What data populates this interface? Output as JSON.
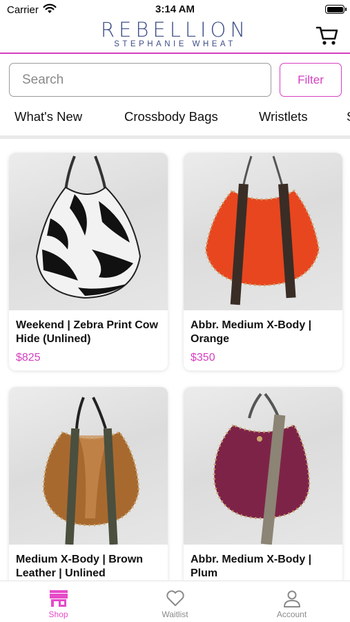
{
  "status": {
    "carrier": "Carrier",
    "time": "3:14 AM"
  },
  "header": {
    "brand": "REBELLION",
    "subtitle": "STEPHANIE WHEAT",
    "cart_icon": "cart-icon"
  },
  "search": {
    "placeholder": "Search",
    "filter_label": "Filter"
  },
  "categories": [
    "What's New",
    "Crossbody Bags",
    "Wristlets",
    "S"
  ],
  "products": [
    {
      "name": "Weekend | Zebra Print Cow Hide (Unlined)",
      "price": "$825"
    },
    {
      "name": "Abbr. Medium X-Body | Orange",
      "price": "$350"
    },
    {
      "name": "Medium X-Body | Brown Leather | Unlined",
      "price": ""
    },
    {
      "name": "Abbr. Medium X-Body | Plum",
      "price": ""
    }
  ],
  "nav": [
    {
      "label": "Shop",
      "icon": "store-icon",
      "active": true
    },
    {
      "label": "Waitlist",
      "icon": "heart-icon",
      "active": false
    },
    {
      "label": "Account",
      "icon": "person-icon",
      "active": false
    }
  ],
  "colors": {
    "accent": "#d63fc0",
    "brand": "#3d4d86"
  }
}
